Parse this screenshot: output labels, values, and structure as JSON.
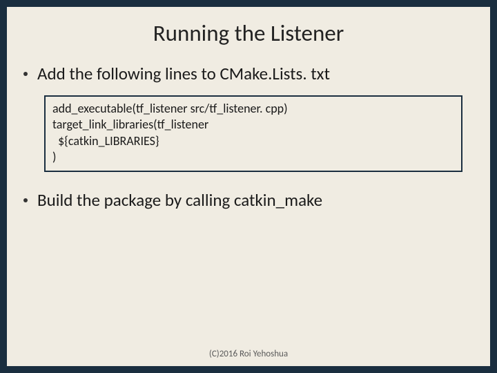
{
  "title": "Running the Listener",
  "bullets": [
    "Add the following lines to CMake.Lists. txt",
    "Build the package by calling catkin_make"
  ],
  "code": {
    "l0": "add_executable(tf_listener src/tf_listener. cpp)",
    "l1": "target_link_libraries(tf_listener",
    "l2": "  ${catkin_LIBRARIES}",
    "l3": ")"
  },
  "footer": "(C)2016 Roi Yehoshua"
}
